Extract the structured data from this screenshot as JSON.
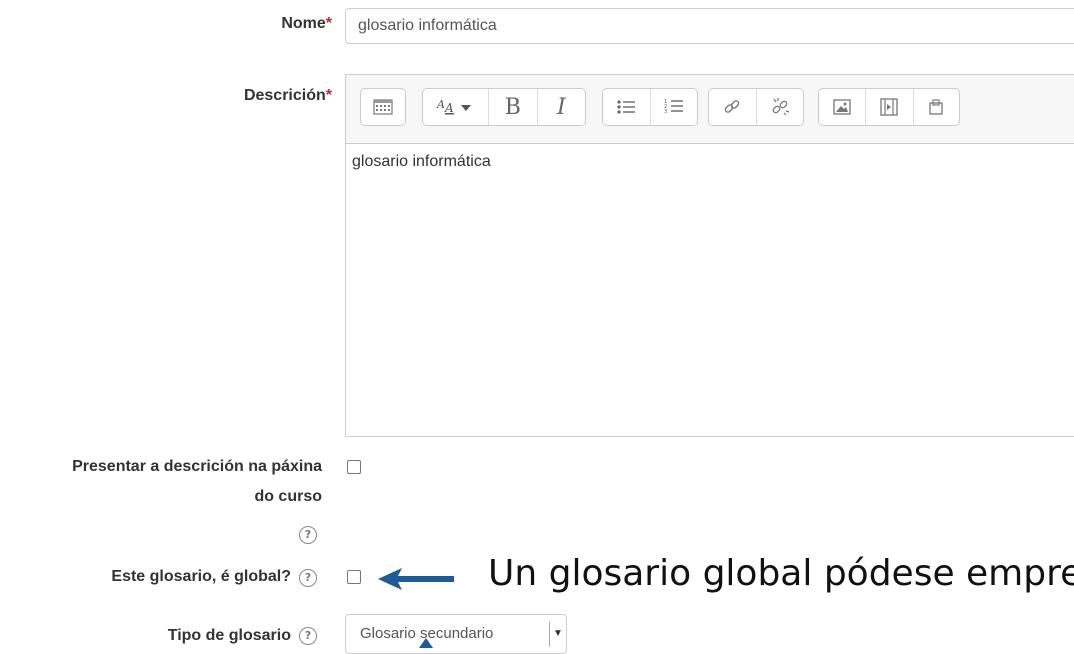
{
  "form": {
    "name": {
      "label": "Nome",
      "required_mark": "*",
      "value": "glosario informática"
    },
    "description": {
      "label": "Descrición",
      "required_mark": "*",
      "content": "glosario informática",
      "toolbar": {
        "groups": [
          [
            "collapse-icon"
          ],
          [
            "font-style-icon",
            "bold-icon",
            "italic-icon"
          ],
          [
            "unordered-list-icon",
            "ordered-list-icon"
          ],
          [
            "link-icon",
            "unlink-icon"
          ],
          [
            "image-icon",
            "media-icon",
            "manage-files-icon"
          ]
        ],
        "bold_glyph": "B",
        "italic_glyph": "I"
      }
    },
    "show_description": {
      "label_line1": "Presentar a descrición na páxina",
      "label_line2": "do curso",
      "checked": false
    },
    "global": {
      "label": "Este glosario, é global?",
      "checked": false
    },
    "glossary_type": {
      "label": "Tipo de glosario",
      "selected": "Glosario secundario"
    }
  },
  "help_glyph": "?",
  "annotation": {
    "text": "Un glosario global pódese empreg",
    "arrow_color": "#1f5b96"
  }
}
